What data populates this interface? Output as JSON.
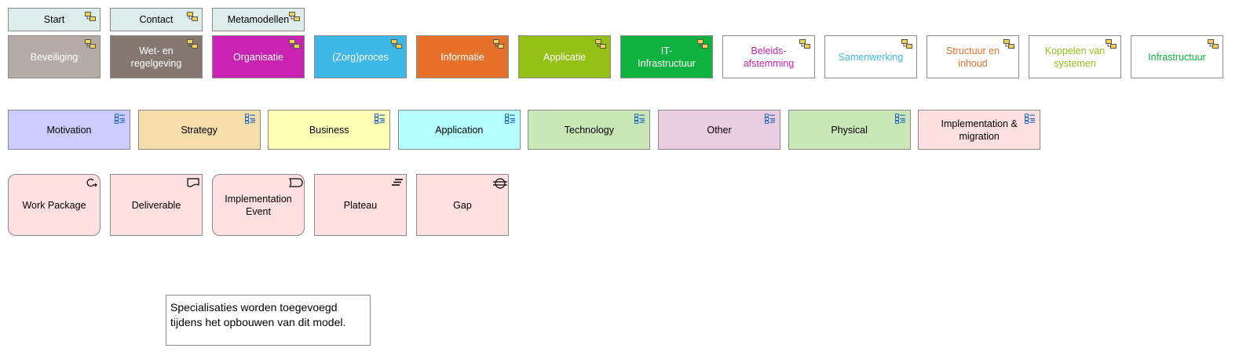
{
  "nav": [
    {
      "id": "start",
      "label": "Start"
    },
    {
      "id": "contact",
      "label": "Contact"
    },
    {
      "id": "metamodellen",
      "label": "Metamodellen"
    }
  ],
  "domains": [
    {
      "id": "beveiliging",
      "label": "Beveiliging",
      "fill": "#b5aca7",
      "text": "#ffffff"
    },
    {
      "id": "wet-en-regelgeving",
      "label": "Wet- en regelgeving",
      "fill": "#857870",
      "text": "#ffffff"
    },
    {
      "id": "organisatie",
      "label": "Organisatie",
      "fill": "#c822b2",
      "text": "#ffffff"
    },
    {
      "id": "zorgproces",
      "label": "(Zorg)proces",
      "fill": "#3fb8e7",
      "text": "#ffffff"
    },
    {
      "id": "informatie",
      "label": "Informatie",
      "fill": "#e5712a",
      "text": "#ffffff"
    },
    {
      "id": "applicatie",
      "label": "Applicatie",
      "fill": "#94bf17",
      "text": "#ffffff"
    },
    {
      "id": "it-infrastructuur",
      "label": "IT-Infrastructuur",
      "fill": "#0fb23e",
      "text": "#ffffff"
    },
    {
      "id": "beleidsafstemming",
      "label": "Beleids-\nafstemming",
      "fill": "#ffffff",
      "text": "#c822b2"
    },
    {
      "id": "samenwerking",
      "label": "Samenwerking",
      "fill": "#ffffff",
      "text": "#3fb8e7"
    },
    {
      "id": "structuur-en-inhoud",
      "label": "Structuur en\ninhoud",
      "fill": "#ffffff",
      "text": "#e5712a"
    },
    {
      "id": "koppelen-van-systemen",
      "label": "Koppelen van\nsystemen",
      "fill": "#ffffff",
      "text": "#94bf17"
    },
    {
      "id": "infrastructuur",
      "label": "Infrastructuur",
      "fill": "#ffffff",
      "text": "#0fb23e"
    }
  ],
  "viewpoints": [
    {
      "id": "motivation",
      "label": "Motivation",
      "fill": "#ccccff"
    },
    {
      "id": "strategy",
      "label": "Strategy",
      "fill": "#f5deaa"
    },
    {
      "id": "business",
      "label": "Business",
      "fill": "#ffffb5"
    },
    {
      "id": "application",
      "label": "Application",
      "fill": "#b5ffff"
    },
    {
      "id": "technology",
      "label": "Technology",
      "fill": "#c9e7b7"
    },
    {
      "id": "other",
      "label": "Other",
      "fill": "#ebcde1"
    },
    {
      "id": "physical",
      "label": "Physical",
      "fill": "#c9e7b7"
    },
    {
      "id": "implementation-migration",
      "label": "Implementation &\nmigration",
      "fill": "#ffe0e0"
    }
  ],
  "elements": [
    {
      "id": "work-package",
      "label": "Work Package",
      "icon": "work-package-icon",
      "rounded": true
    },
    {
      "id": "deliverable",
      "label": "Deliverable",
      "icon": "deliverable-icon",
      "rounded": false
    },
    {
      "id": "implementation-event",
      "label": "Implementation\nEvent",
      "icon": "event-icon",
      "rounded": true
    },
    {
      "id": "plateau",
      "label": "Plateau",
      "icon": "plateau-icon",
      "rounded": false
    },
    {
      "id": "gap",
      "label": "Gap",
      "icon": "gap-icon",
      "rounded": false
    }
  ],
  "colors": {
    "nav_fill": "#dcedeb",
    "impl_fill": "#ffe0e0",
    "viewpoint_icon": "#2e6fc1",
    "model_icon_fill": "#f0d050"
  },
  "note": "Specialisaties worden toegevoegd\ntijdens het opbouwen van dit model."
}
